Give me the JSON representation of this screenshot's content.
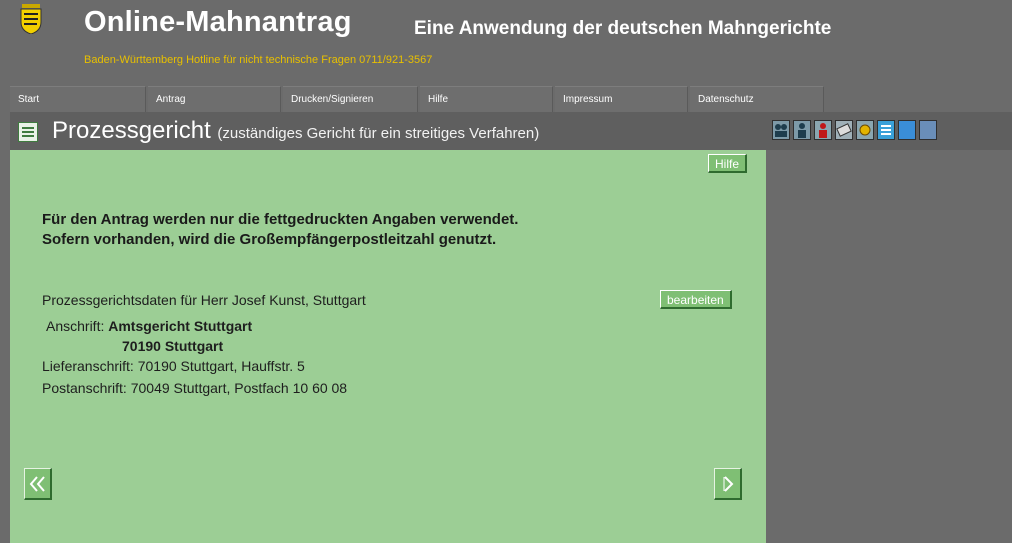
{
  "header": {
    "title": "Online-Mahnantrag",
    "subtitle": "Eine Anwendung der deutschen Mahngerichte",
    "hotline": "Baden-Württemberg   Hotline für nicht technische Fragen 0711/921-3567"
  },
  "nav": {
    "items": [
      {
        "label": "Start"
      },
      {
        "label": "Antrag"
      },
      {
        "label": "Drucken/Signieren"
      },
      {
        "label": "Hilfe"
      },
      {
        "label": "Impressum"
      },
      {
        "label": "Datenschutz"
      }
    ]
  },
  "section": {
    "title": "Prozessgericht",
    "subtitle": "(zuständiges Gericht für ein streitiges Verfahren)"
  },
  "toolbar": {
    "icons": [
      "people-icon",
      "person-icon",
      "person-red-icon",
      "money-icon",
      "coins-icon",
      "list-icon",
      "page-icon",
      "printer-icon"
    ]
  },
  "panel": {
    "help_label": "Hilfe",
    "intro_line1": "Für den Antrag werden nur die fettgedruckten Angaben verwendet.",
    "intro_line2": "Sofern vorhanden, wird die Großempfängerpostleitzahl genutzt.",
    "court_data_label": "Prozessgerichtsdaten für Herr Josef Kunst, Stuttgart",
    "edit_label": "bearbeiten",
    "address_label": "Anschrift:",
    "address_line1": "Amtsgericht Stuttgart",
    "address_line2": "70190 Stuttgart",
    "delivery_label": "Lieferanschrift:",
    "delivery_value": "70190 Stuttgart, Hauffstr. 5",
    "postal_label": "Postanschrift:",
    "postal_value": "70049 Stuttgart, Postfach 10 60 08"
  },
  "colors": {
    "panel_bg": "#9cce95",
    "header_bg": "#6b6b6b",
    "hotline": "#e8c000"
  }
}
